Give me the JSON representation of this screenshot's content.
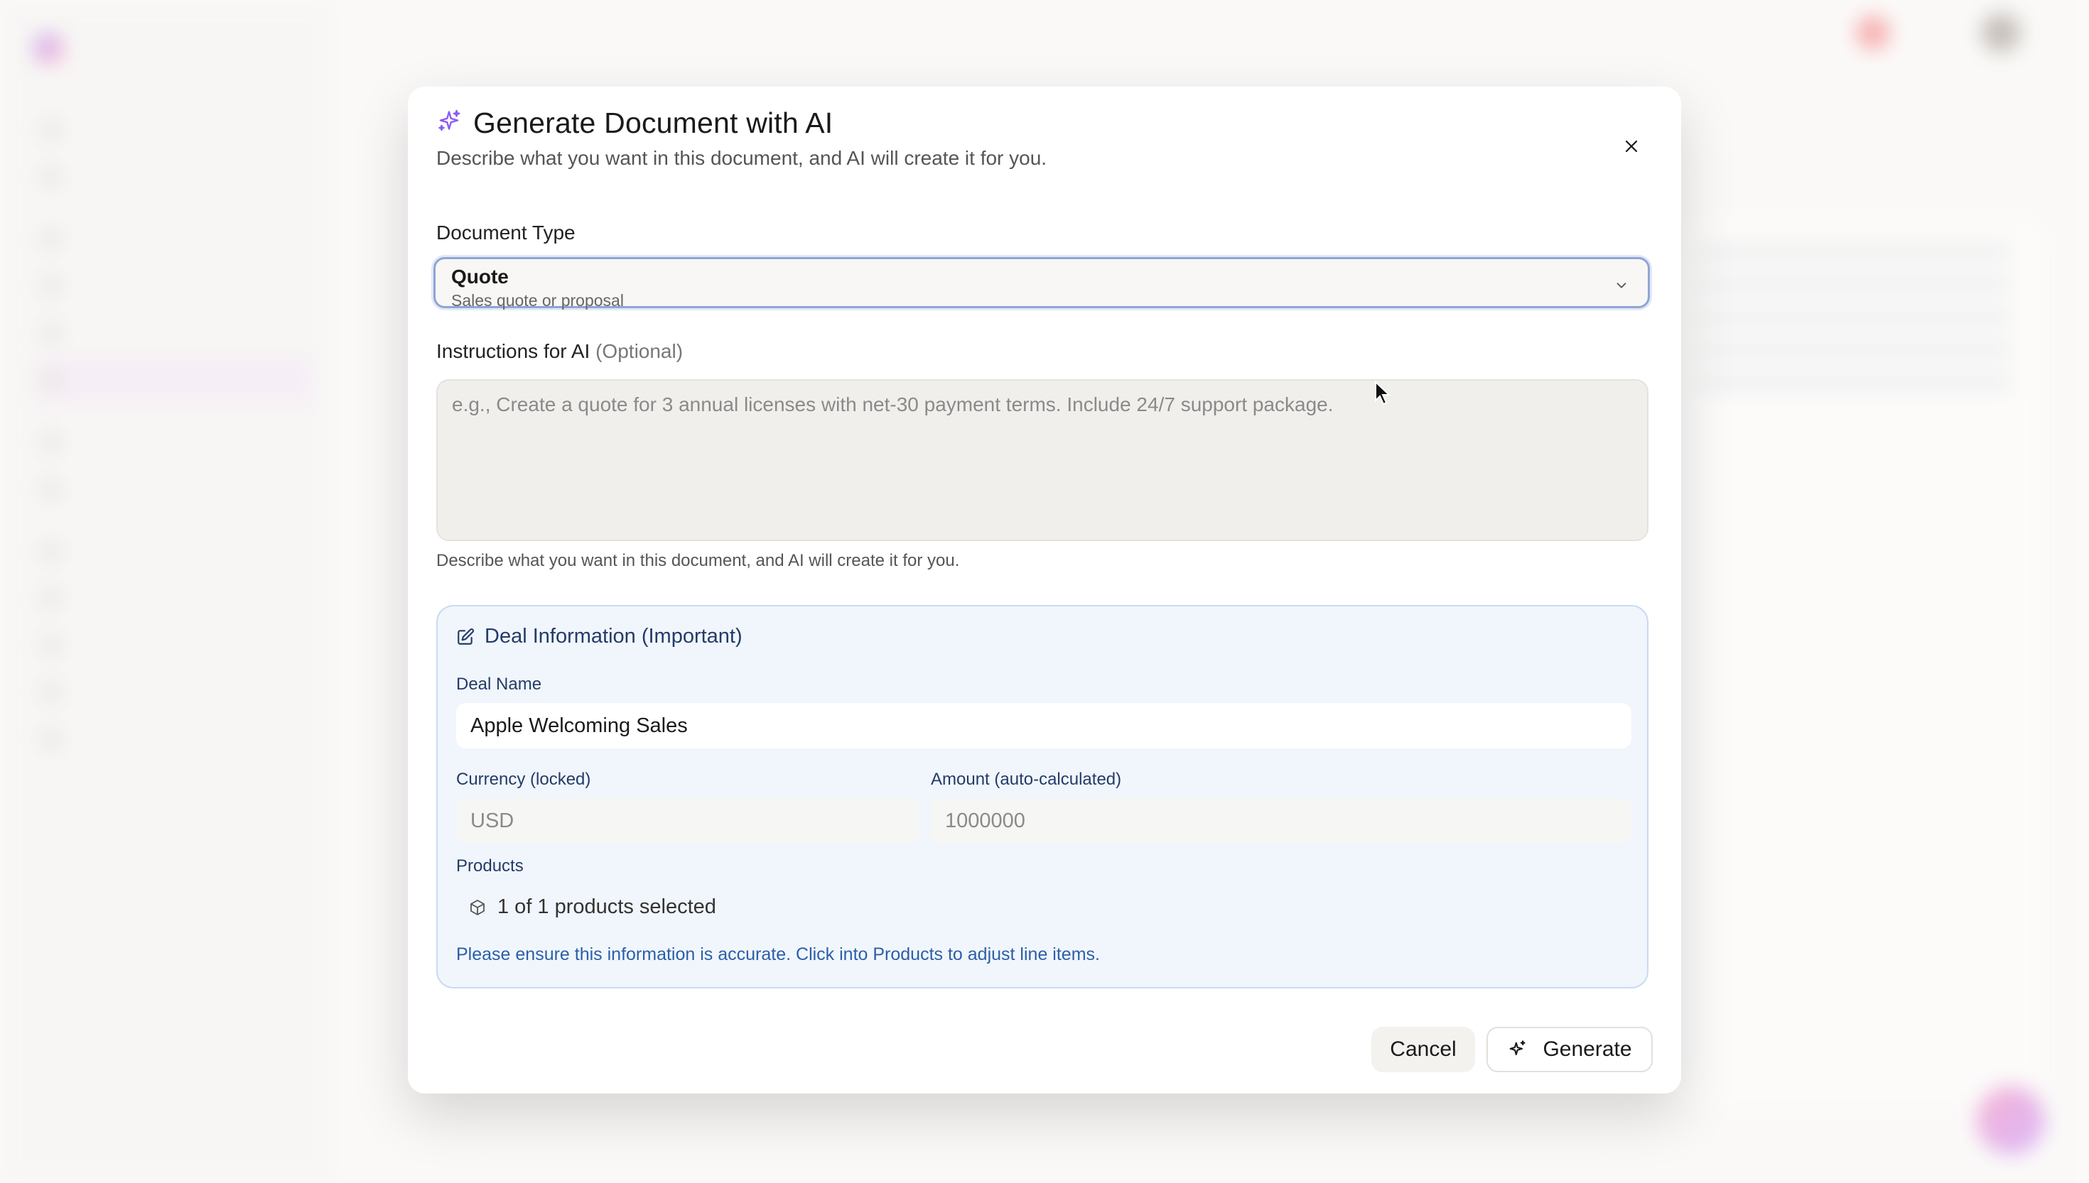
{
  "modal": {
    "title": "Generate Document with AI",
    "subtitle": "Describe what you want in this document, and AI will create it for you.",
    "close_icon": "close-icon",
    "title_icon": "sparkle-icon",
    "accent_color": "#8b5cf6"
  },
  "document_type": {
    "label": "Document Type",
    "selected_value": "Quote",
    "selected_description": "Sales quote or proposal",
    "icon": "chevron-down-icon"
  },
  "instructions": {
    "label": "Instructions for AI",
    "label_optional": "(Optional)",
    "value": "",
    "placeholder": "e.g., Create a quote for 3 annual licenses with net-30 payment terms. Include 24/7 support package.",
    "help": "Describe what you want in this document, and AI will create it for you."
  },
  "deal_info": {
    "title": "Deal Information (Important)",
    "icon": "edit-icon",
    "deal_name_label": "Deal Name",
    "deal_name_value": "Apple Welcoming Sales",
    "currency_label": "Currency (locked)",
    "currency_value": "USD",
    "amount_label": "Amount (auto-calculated)",
    "amount_value": "1000000",
    "products_label": "Products",
    "products_summary": "1 of 1 products selected",
    "products_icon": "box-icon",
    "notice": "Please ensure this information is accurate. Click into Products to adjust line items.",
    "border_color": "#c9dbef",
    "background_color": "#f1f6fc",
    "notice_color": "#2b5fa8"
  },
  "footer": {
    "cancel_label": "Cancel",
    "generate_label": "Generate",
    "generate_icon": "sparkle-icon"
  }
}
